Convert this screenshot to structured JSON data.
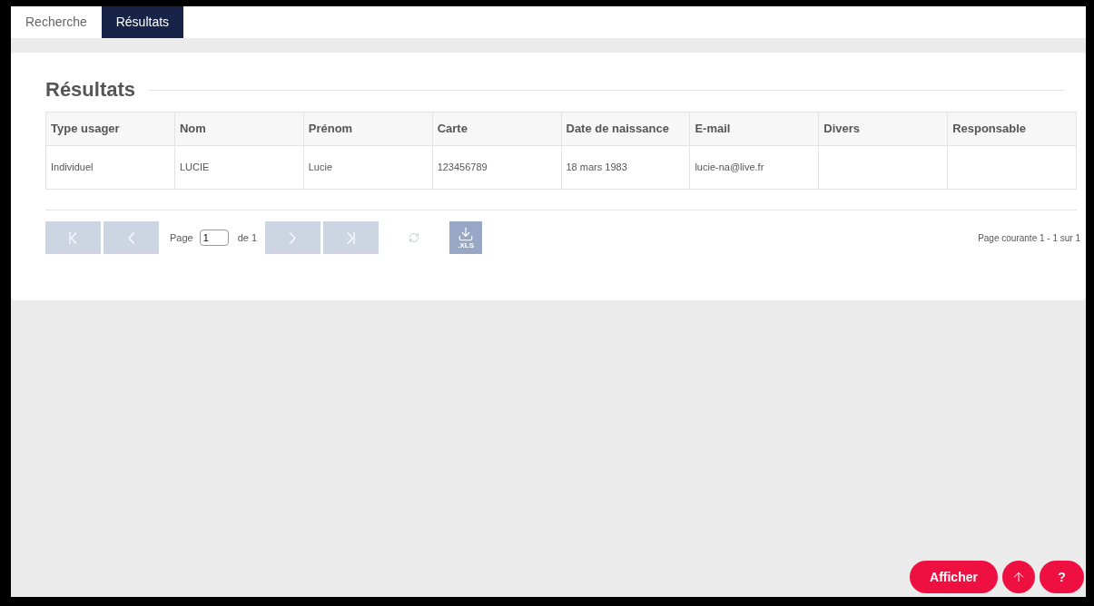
{
  "tabs": [
    {
      "label": "Recherche",
      "selected": false
    },
    {
      "label": "Résultats",
      "selected": true
    }
  ],
  "title": "Résultats",
  "table": {
    "columns": [
      "Type usager",
      "Nom",
      "Prénom",
      "Carte",
      "Date de naissance",
      "E-mail",
      "Divers",
      "Responsable"
    ],
    "rows": [
      [
        "Individuel",
        "LUCIE",
        "Lucie",
        "123456789",
        "18 mars 1983",
        "lucie-na@live.fr",
        "",
        ""
      ]
    ]
  },
  "pager": {
    "first_disabled": true,
    "prev_disabled": true,
    "page_label": "Page",
    "page_value": "1",
    "of_label": "de 1",
    "next_disabled": true,
    "last_disabled": true,
    "export_label": ".XLS",
    "status": "Page courante 1 - 1 sur 1"
  },
  "actions": {
    "show": "Afficher",
    "help": "?"
  }
}
